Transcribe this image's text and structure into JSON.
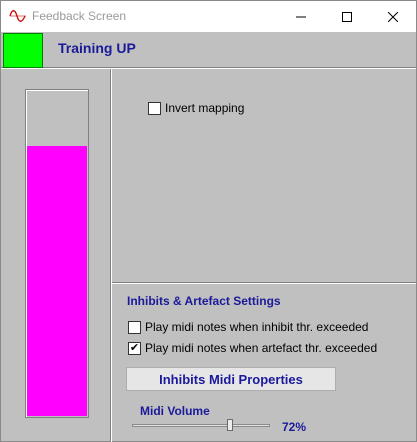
{
  "window": {
    "title": "Feedback Screen",
    "icon": "sine-wave-icon"
  },
  "header": {
    "status_color": "#00ff00",
    "title": "Training UP"
  },
  "meter": {
    "fill_color": "#ff00ff",
    "level_fraction": 0.83
  },
  "mapping": {
    "invert_label": "Invert mapping",
    "invert_checked": false
  },
  "inhibits": {
    "section_title": "Inhibits & Artefact Settings",
    "inhibit_label": "Play midi notes when inhibit thr. exceeded",
    "inhibit_checked": false,
    "artefact_label": "Play midi notes when artefact thr. exceeded",
    "artefact_checked": true,
    "properties_button": "Inhibits Midi Properties"
  },
  "volume": {
    "label": "Midi Volume",
    "value_text": "72%",
    "value": 72
  }
}
